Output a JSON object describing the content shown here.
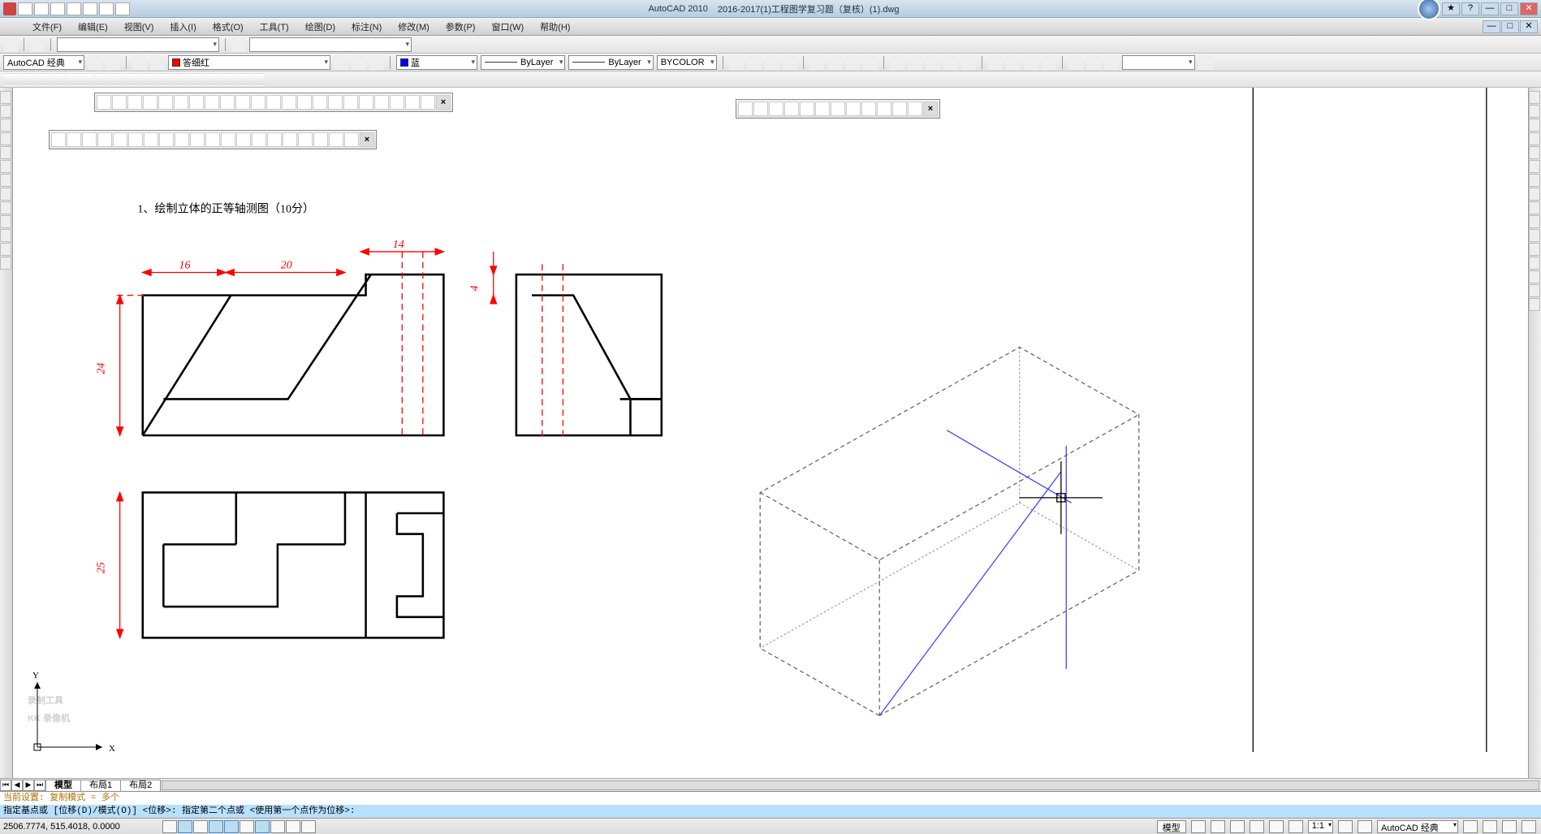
{
  "title": {
    "app": "AutoCAD 2010",
    "file": "2016-2017(1)工程图学复习题（复核）(1).dwg"
  },
  "menu": {
    "file": "文件(F)",
    "edit": "编辑(E)",
    "view": "视图(V)",
    "insert": "插入(I)",
    "format": "格式(O)",
    "tools": "工具(T)",
    "draw": "绘图(D)",
    "dimension": "标注(N)",
    "modify": "修改(M)",
    "param": "参数(P)",
    "window": "窗口(W)",
    "help": "帮助(H)"
  },
  "workspace": {
    "current": "AutoCAD 经典"
  },
  "layer": {
    "current": "答细红"
  },
  "props": {
    "color": "蓝",
    "linetype": "ByLayer",
    "lineweight": "ByLayer",
    "plotstyle": "BYCOLOR"
  },
  "drawing": {
    "problem_title": "1、绘制立体的正等轴测图（10分）",
    "dims": {
      "d16": "16",
      "d20": "20",
      "d14": "14",
      "d24": "24",
      "d4": "4",
      "d25": "25"
    },
    "axes": {
      "x": "X",
      "y": "Y"
    },
    "watermark_line1": "录制工具",
    "watermark_line2": "KK 录像机"
  },
  "layouts": {
    "model": "模型",
    "layout1": "布局1",
    "layout2": "布局2"
  },
  "command": {
    "line1": "当前设置:  复制模式 = 多个",
    "line2": "指定基点或 [位移(D)/模式(O)] <位移>:  指定第二个点或 <使用第一个点作为位移>:"
  },
  "status": {
    "coords": "2506.7774, 515.4018, 0.0000",
    "scale": "1:1",
    "ws_label": "AutoCAD 经典",
    "model_btn": "模型"
  }
}
